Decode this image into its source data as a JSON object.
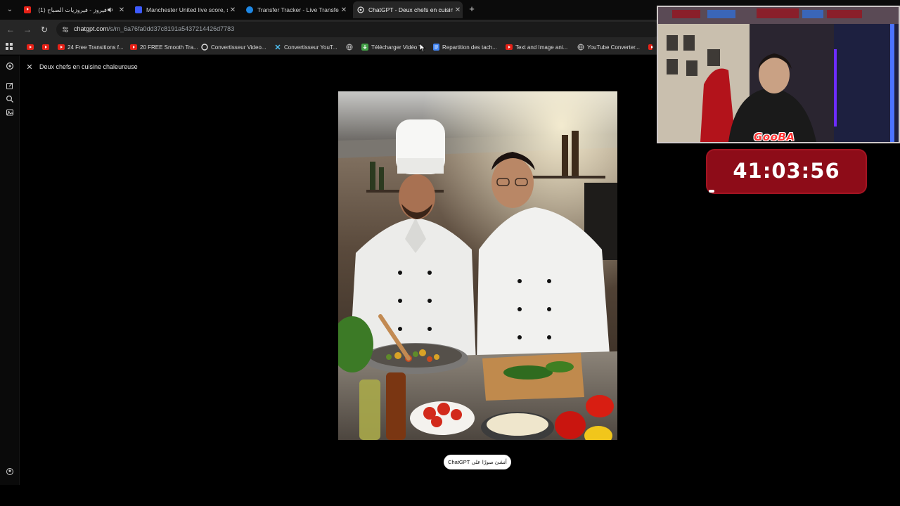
{
  "tabs": [
    {
      "title": "فيروز - فيروزيات الصباح (1)",
      "favicon_color": "#e62117",
      "has_audio": true
    },
    {
      "title": "Manchester United live score, s",
      "favicon_color": "#3d5afe"
    },
    {
      "title": "Transfer Tracker - Live Transfer N",
      "favicon_color": "#1e88e5"
    },
    {
      "title": "ChatGPT - Deux chefs en cuisine",
      "favicon_color": "#cfcfcf",
      "active": true
    }
  ],
  "address_bar": {
    "host": "chatgpt.com",
    "path": "/s/m_6a76fa0dd37c8191a5437214426d7783"
  },
  "bookmarks": [
    {
      "label": "",
      "icon": "youtube-icon"
    },
    {
      "label": "",
      "icon": "youtube-icon"
    },
    {
      "label": "24 Free Transitions f...",
      "icon": "youtube-icon"
    },
    {
      "label": "20 FREE Smooth Tra...",
      "icon": "youtube-icon"
    },
    {
      "label": "Convertisseur Video...",
      "icon": "google-icon"
    },
    {
      "label": "Convertisseur YouT...",
      "icon": "converter-icon"
    },
    {
      "label": "",
      "icon": "globe-icon"
    },
    {
      "label": "Télécharger Vidéo Y",
      "icon": "download-icon"
    },
    {
      "label": "Repartition des tach...",
      "icon": "docs-icon"
    },
    {
      "label": "Text and Image ani...",
      "icon": "youtube-icon"
    },
    {
      "label": "YouTube Converter...",
      "icon": "globe-icon"
    }
  ],
  "page": {
    "title": "Deux chefs en cuisine chaleureuse",
    "cta_label": "أنشئ صورًا على ChatGPT"
  },
  "overlay": {
    "brand": "GooBA",
    "timer": "41:03:56"
  },
  "colors": {
    "youtube": "#e62117",
    "timer_bg": "#8d0c18",
    "brand": "#ff3535"
  }
}
